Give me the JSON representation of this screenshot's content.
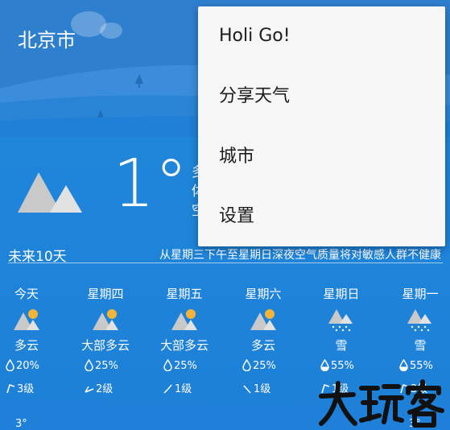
{
  "header": {
    "city": "北京市"
  },
  "current": {
    "temperature": "1°",
    "details": [
      "多",
      "体",
      "空"
    ]
  },
  "forecast": {
    "title": "未来10天",
    "note": "从星期三下午至星期日深夜空气质量将对敏感人群不健康",
    "days": [
      {
        "name": "今天",
        "condition": "多云",
        "icon": "partly-cloudy-icon",
        "pop": "20%",
        "wind": "3级",
        "temp": "3°"
      },
      {
        "name": "星期四",
        "condition": "大部多云",
        "icon": "partly-cloudy-icon",
        "pop": "25%",
        "wind": "2级",
        "temp": ""
      },
      {
        "name": "星期五",
        "condition": "大部多云",
        "icon": "partly-cloudy-icon",
        "pop": "25%",
        "wind": "1级",
        "temp": ""
      },
      {
        "name": "星期六",
        "condition": "多云",
        "icon": "partly-cloudy-icon",
        "pop": "25%",
        "wind": "1级",
        "temp": ""
      },
      {
        "name": "星期日",
        "condition": "雪",
        "icon": "snow-icon",
        "pop": "55%",
        "wind": "1级",
        "temp": ""
      },
      {
        "name": "星期一",
        "condition": "雪",
        "icon": "snow-icon",
        "pop": "55%",
        "wind": "3级",
        "temp": "3°"
      }
    ]
  },
  "menu": {
    "items": [
      "Holi Go!",
      "分享天气",
      "城市",
      "设置"
    ]
  },
  "watermark": {
    "text": "大玩客"
  },
  "colors": {
    "background": "#1E80D8",
    "menu_background": "#F6F6F6",
    "sun": "#F4B43A",
    "mountain": "#D5D5D5"
  }
}
